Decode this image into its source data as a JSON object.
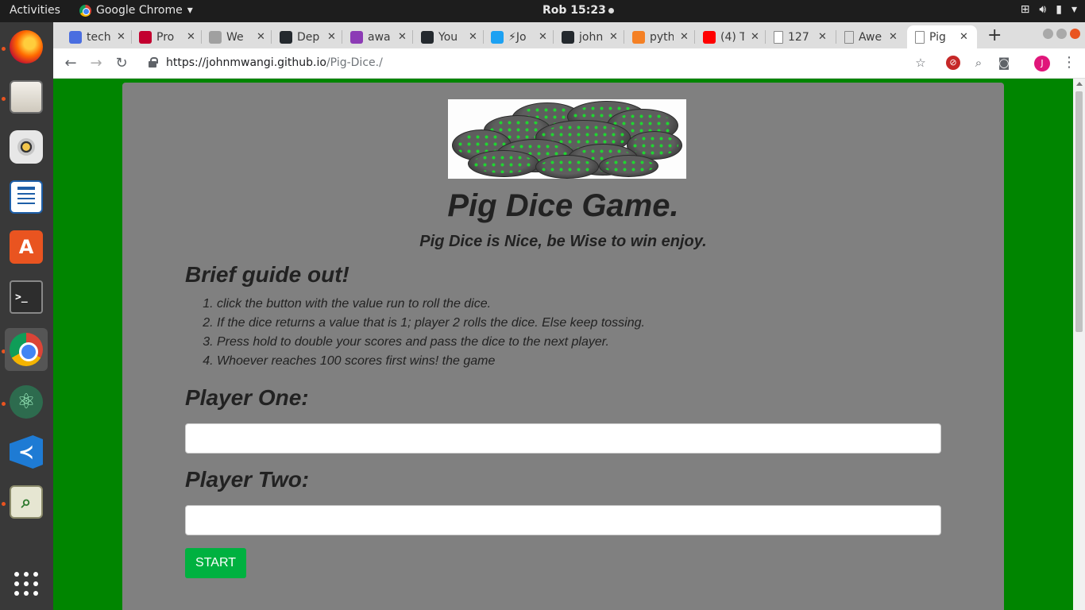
{
  "topbar": {
    "activities": "Activities",
    "app_name": "Google Chrome",
    "clock": "Rob 15:23"
  },
  "dock": {
    "apps": [
      "firefox-icon",
      "files-icon",
      "rhythmbox-icon",
      "libreoffice-writer-icon",
      "software-center-icon",
      "terminal-icon",
      "chrome-icon",
      "atom-icon",
      "vscode-icon",
      "image-viewer-icon",
      "show-applications-icon"
    ]
  },
  "browser": {
    "tabs": [
      {
        "title": "tech",
        "favicon_color": "#4a6ee0",
        "favicon": "docs-icon"
      },
      {
        "title": "Pro",
        "favicon_color": "#c3002f",
        "favicon": "angular-icon"
      },
      {
        "title": "We",
        "favicon_color": "#a0a0a0",
        "favicon": "github-icon"
      },
      {
        "title": "Dep",
        "favicon_color": "#24292e",
        "favicon": "github-icon"
      },
      {
        "title": "awa",
        "favicon_color": "#8c3bb5",
        "favicon": "heroku-icon"
      },
      {
        "title": "You",
        "favicon_color": "#24292e",
        "favicon": "github-icon"
      },
      {
        "title": "⚡Jo",
        "favicon_color": "#1da1f2",
        "favicon": "twitter-icon"
      },
      {
        "title": "john",
        "favicon_color": "#24292e",
        "favicon": "github-icon"
      },
      {
        "title": "pyth",
        "favicon_color": "#f48024",
        "favicon": "stackoverflow-icon"
      },
      {
        "title": "(4) T",
        "favicon_color": "#ff0000",
        "favicon": "youtube-icon"
      },
      {
        "title": "127",
        "favicon_color": "#ffffff",
        "favicon": "page-icon"
      },
      {
        "title": "Awe",
        "favicon_color": "#dddddd",
        "favicon": "page-icon"
      },
      {
        "title": "Pig",
        "favicon_color": "#ffffff",
        "favicon": "page-icon",
        "active": true
      }
    ],
    "url_host": "https://johnmwangi.github.io",
    "url_path": "/Pig-Dice./",
    "profile_initial": "J"
  },
  "page": {
    "background": "#008500",
    "card_bg": "#808080",
    "title": "Pig Dice Game.",
    "subtitle": "Pig Dice is Nice, be Wise to win enjoy.",
    "guide_heading": "Brief guide out!",
    "steps": [
      "click the button with the value run to roll the dice.",
      "If the dice returns a value that is 1; player 2 rolls the dice. Else keep tossing.",
      "Press hold to double your scores and pass the dice to the next player.",
      "Whoever reaches 100 scores first wins! the game"
    ],
    "player_one_label": "Player One:",
    "player_one_value": "",
    "player_two_label": "Player Two:",
    "player_two_value": "",
    "start_label": "START",
    "start_color": "#00b140"
  }
}
